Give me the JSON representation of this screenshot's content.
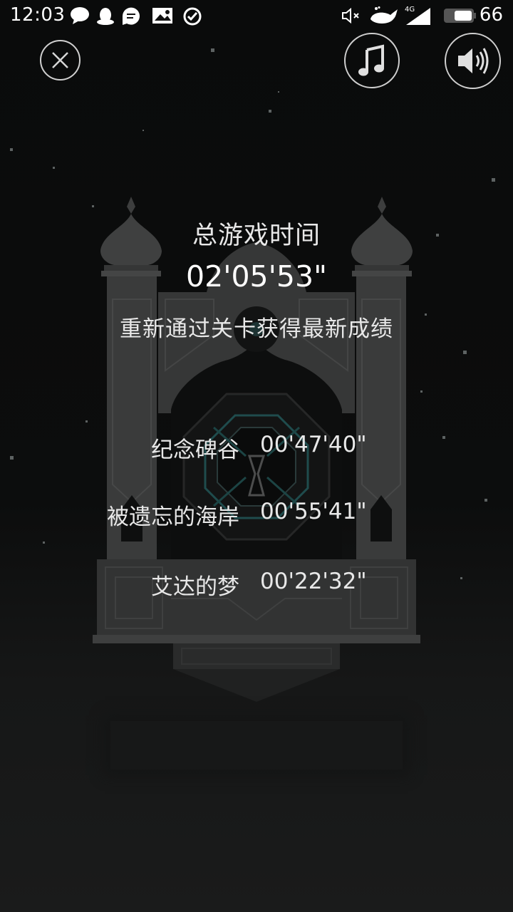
{
  "status_bar": {
    "time": "12:03",
    "network": "4G",
    "battery": "66",
    "icons": [
      "chat-bubble-icon",
      "qq-penguin-icon",
      "message-icon",
      "image-notification-icon",
      "check-circle-icon",
      "vibrate-mute-icon",
      "whale-icon",
      "signal-icon",
      "battery-icon"
    ]
  },
  "toolbar": {
    "close_icon": "close-icon",
    "music_icon": "music-note-icon",
    "sound_icon": "speaker-icon"
  },
  "summary": {
    "total_label": "总游戏时间",
    "total_time": "02'05'53\"",
    "replay_hint": "重新通过关卡获得最新成绩"
  },
  "levels": [
    {
      "name": "纪念碑谷",
      "time": "00'47'40\""
    },
    {
      "name": "被遗忘的海岸",
      "time": "00'55'41\""
    },
    {
      "name": "艾达的梦",
      "time": "00'22'32\""
    }
  ],
  "colors": {
    "background": "#0b0c0c",
    "building": "#3b3c3c",
    "building_dark": "#2e2f2f",
    "text": "#e8e8e8",
    "accent_teal": "#2f6f70"
  }
}
